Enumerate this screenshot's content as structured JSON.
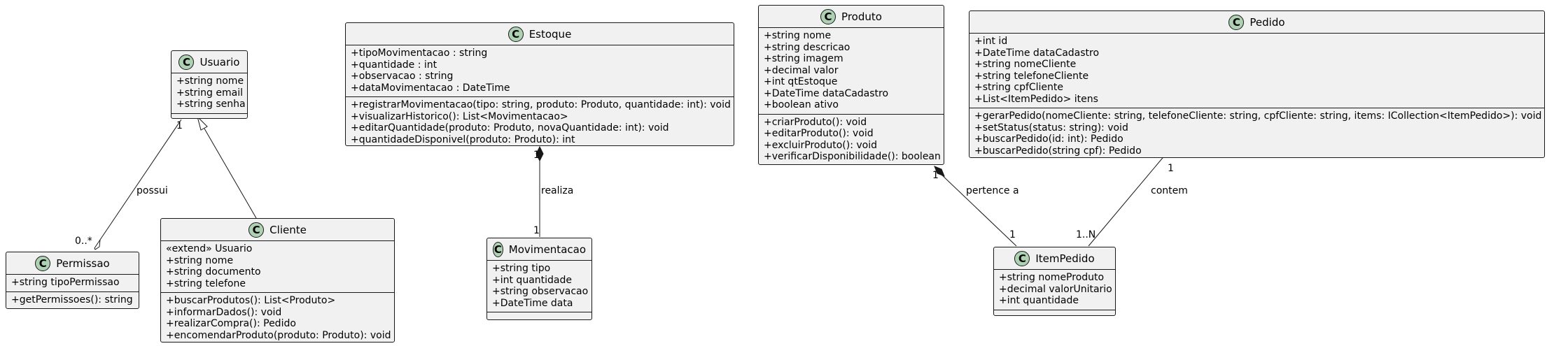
{
  "classes": {
    "usuario": {
      "name": "Usuario",
      "badge": "C",
      "attributes": [
        "+string nome",
        "+string email",
        "+string senha"
      ],
      "methods": []
    },
    "permissao": {
      "name": "Permissao",
      "badge": "C",
      "attributes": [
        "+string tipoPermissao"
      ],
      "methods": [
        "+getPermissoes(): string"
      ]
    },
    "cliente": {
      "name": "Cliente",
      "badge": "C",
      "attributes": [
        "«extend» Usuario",
        "+string nome",
        "+string documento",
        "+string telefone"
      ],
      "methods": [
        "+buscarProdutos(): List<Produto>",
        "+informarDados(): void",
        "+realizarCompra(): Pedido",
        "+encomendarProduto(produto: Produto): void"
      ]
    },
    "estoque": {
      "name": "Estoque",
      "badge": "C",
      "attributes": [
        "+tipoMovimentacao : string",
        "+quantidade : int",
        "+observacao : string",
        "+dataMovimentacao : DateTime"
      ],
      "methods": [
        "+registrarMovimentacao(tipo: string, produto: Produto, quantidade: int): void",
        "+visualizarHistorico(): List<Movimentacao>",
        "+editarQuantidade(produto: Produto, novaQuantidade: int): void",
        "+quantidadeDisponivel(produto: Produto): int"
      ]
    },
    "movimentacao": {
      "name": "Movimentacao",
      "badge": "C",
      "attributes": [
        "+string tipo",
        "+int quantidade",
        "+string observacao",
        "+DateTime data"
      ],
      "methods": []
    },
    "produto": {
      "name": "Produto",
      "badge": "C",
      "attributes": [
        "+string nome",
        "+string descricao",
        "+string imagem",
        "+decimal valor",
        "+int qtEstoque",
        "+DateTime dataCadastro",
        "+boolean ativo"
      ],
      "methods": [
        "+criarProduto(): void",
        "+editarProduto(): void",
        "+excluirProduto(): void",
        "+verificarDisponibilidade(): boolean"
      ]
    },
    "pedido": {
      "name": "Pedido",
      "badge": "C",
      "attributes": [
        "+int id",
        "+DateTime dataCadastro",
        "+string nomeCliente",
        "+string telefoneCliente",
        "+string cpfCliente",
        "+List<ItemPedido> itens"
      ],
      "methods": [
        "+gerarPedido(nomeCliente: string, telefoneCliente: string, cpfCliente: string, items: ICollection<ItemPedido>): void",
        "+setStatus(status: string): void",
        "+buscarPedido(id: int): Pedido",
        "+buscarPedido(string cpf): Pedido"
      ]
    },
    "itempedido": {
      "name": "ItemPedido",
      "badge": "C",
      "attributes": [
        "+string nomeProduto",
        "+decimal valorUnitario",
        "+int quantidade"
      ],
      "methods": []
    }
  },
  "relations": {
    "usuario_permissao": {
      "label": "possui",
      "source_mult": "1",
      "target_mult": "0..*"
    },
    "estoque_movimentacao": {
      "label": "realiza",
      "source_mult": "1",
      "target_mult": "1"
    },
    "produto_itempedido": {
      "label": "pertence a",
      "source_mult": "1",
      "target_mult": "1"
    },
    "pedido_itempedido": {
      "label": "contem",
      "source_mult": "1",
      "target_mult": "1..N"
    }
  },
  "colors": {
    "class_fill": "#f1f1f1",
    "border": "#181818",
    "badge_fill": "#add1b2"
  }
}
